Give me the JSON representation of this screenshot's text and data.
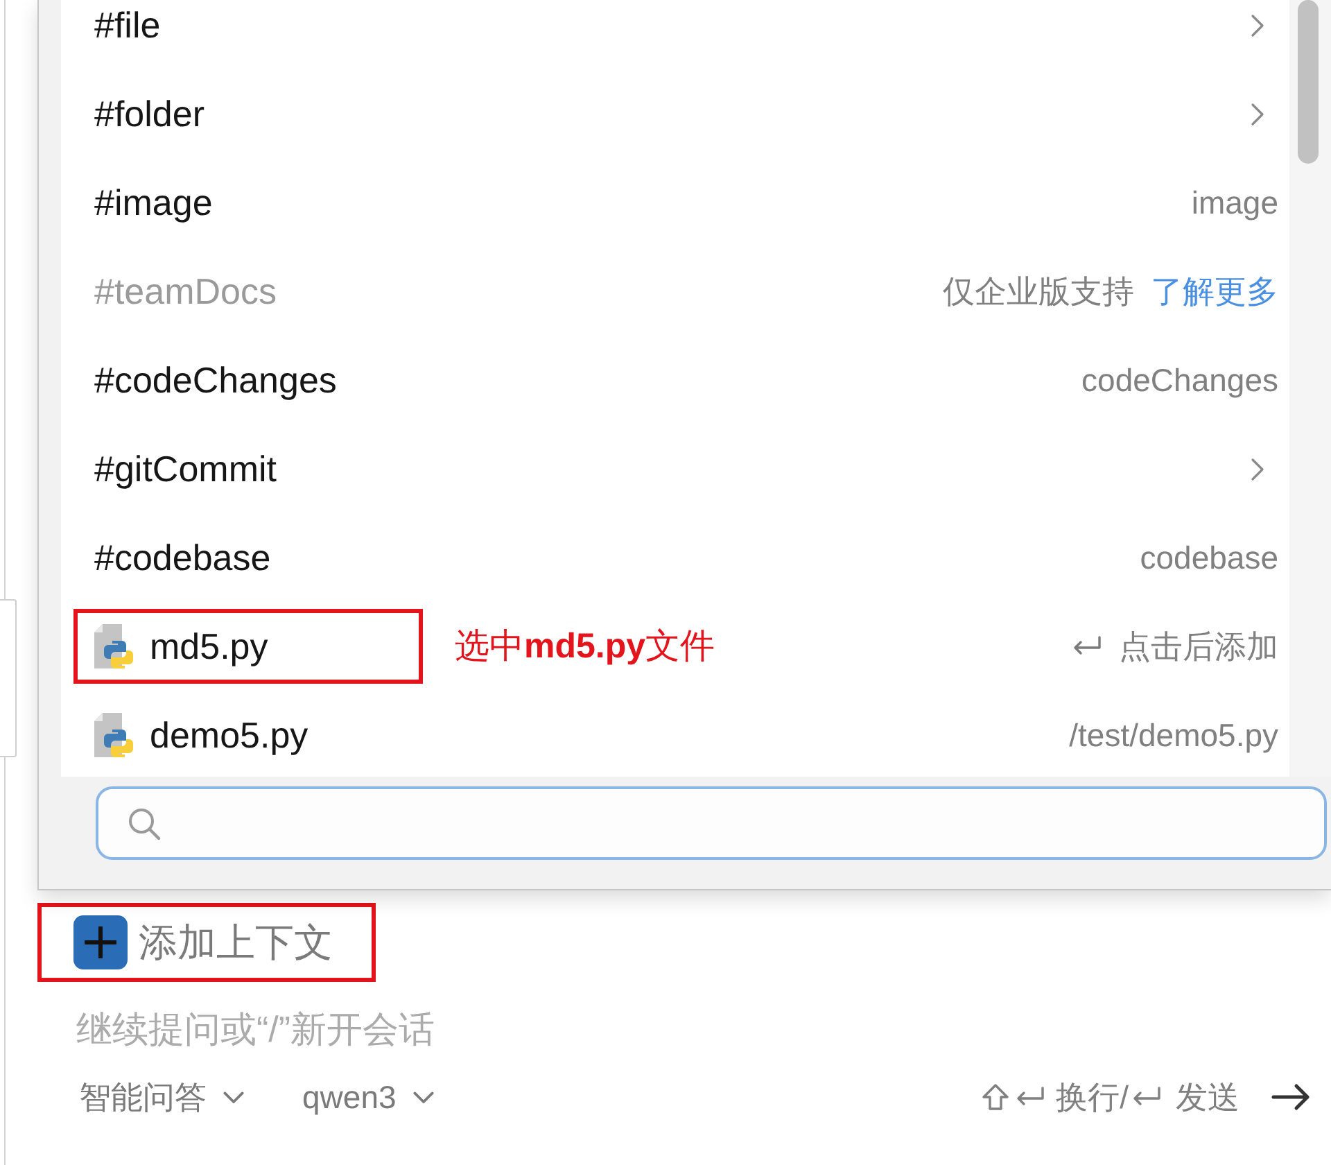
{
  "context_menu": {
    "items": [
      {
        "kind": "submenu",
        "label": "#file",
        "disabled": false,
        "selected": false,
        "annotated": false
      },
      {
        "kind": "submenu",
        "label": "#folder",
        "disabled": false,
        "selected": false,
        "annotated": false
      },
      {
        "kind": "option",
        "label": "#image",
        "hint": "image",
        "disabled": false,
        "selected": false,
        "annotated": false
      },
      {
        "kind": "option",
        "label": "#teamDocs",
        "note": "仅企业版支持",
        "link": "了解更多",
        "disabled": true,
        "selected": false,
        "annotated": false
      },
      {
        "kind": "option",
        "label": "#codeChanges",
        "hint": "codeChanges",
        "disabled": false,
        "selected": false,
        "annotated": false
      },
      {
        "kind": "submenu",
        "label": "#gitCommit",
        "disabled": false,
        "selected": false,
        "annotated": false
      },
      {
        "kind": "option",
        "label": "#codebase",
        "hint": "codebase",
        "disabled": false,
        "selected": false,
        "annotated": false
      },
      {
        "kind": "file",
        "label": "md5.py",
        "hint": "点击后添加",
        "disabled": false,
        "selected": true,
        "annotated": true,
        "callout": "选中**md5.py**文件"
      },
      {
        "kind": "file",
        "label": "demo5.py",
        "hint": "/test/demo5.py",
        "disabled": false,
        "selected": false,
        "annotated": false
      }
    ]
  },
  "search_field": {
    "focused": true
  },
  "composer": {
    "add_context_button": {
      "label": "添加上下文",
      "annotated": true
    },
    "message_input": {
      "placeholder": "继续提问或“/”新开会话"
    },
    "mode_dropdown": {
      "label": "智能问答"
    },
    "model_dropdown": {
      "label": "qwen3"
    },
    "shortcut_hint": {
      "newline_label": "换行/",
      "send_label": "发送"
    }
  }
}
